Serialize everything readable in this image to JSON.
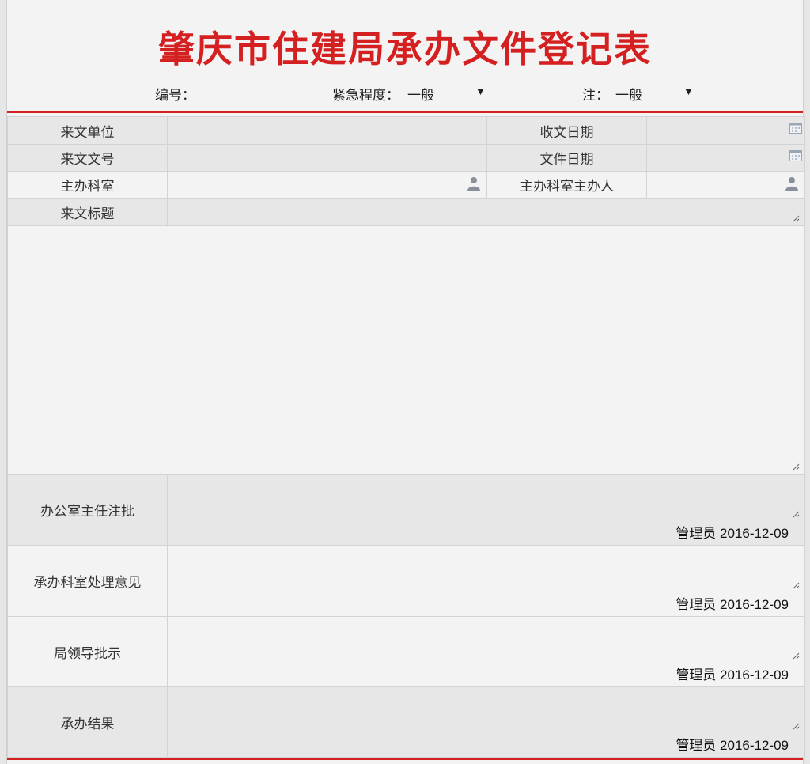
{
  "form": {
    "title": "肇庆市住建局承办文件登记表",
    "number_label": "编号：",
    "urgency_label": "紧急程度：",
    "urgency_value": "一般",
    "note_label": "注：",
    "note_value": "一般"
  },
  "rows": {
    "sender_unit_label": "来文单位",
    "received_date_label": "收文日期",
    "doc_number_label": "来文文号",
    "file_date_label": "文件日期",
    "host_dept_label": "主办科室",
    "host_person_label": "主办科室主办人",
    "doc_title_label": "来文标题"
  },
  "approvals": [
    {
      "label": "办公室主任注批",
      "signer": "管理员 2016-12-09"
    },
    {
      "label": "承办科室处理意见",
      "signer": "管理员 2016-12-09"
    },
    {
      "label": "局领导批示",
      "signer": "管理员 2016-12-09"
    },
    {
      "label": "承办结果",
      "signer": "管理员 2016-12-09"
    }
  ],
  "colors": {
    "accent": "#d42020"
  }
}
